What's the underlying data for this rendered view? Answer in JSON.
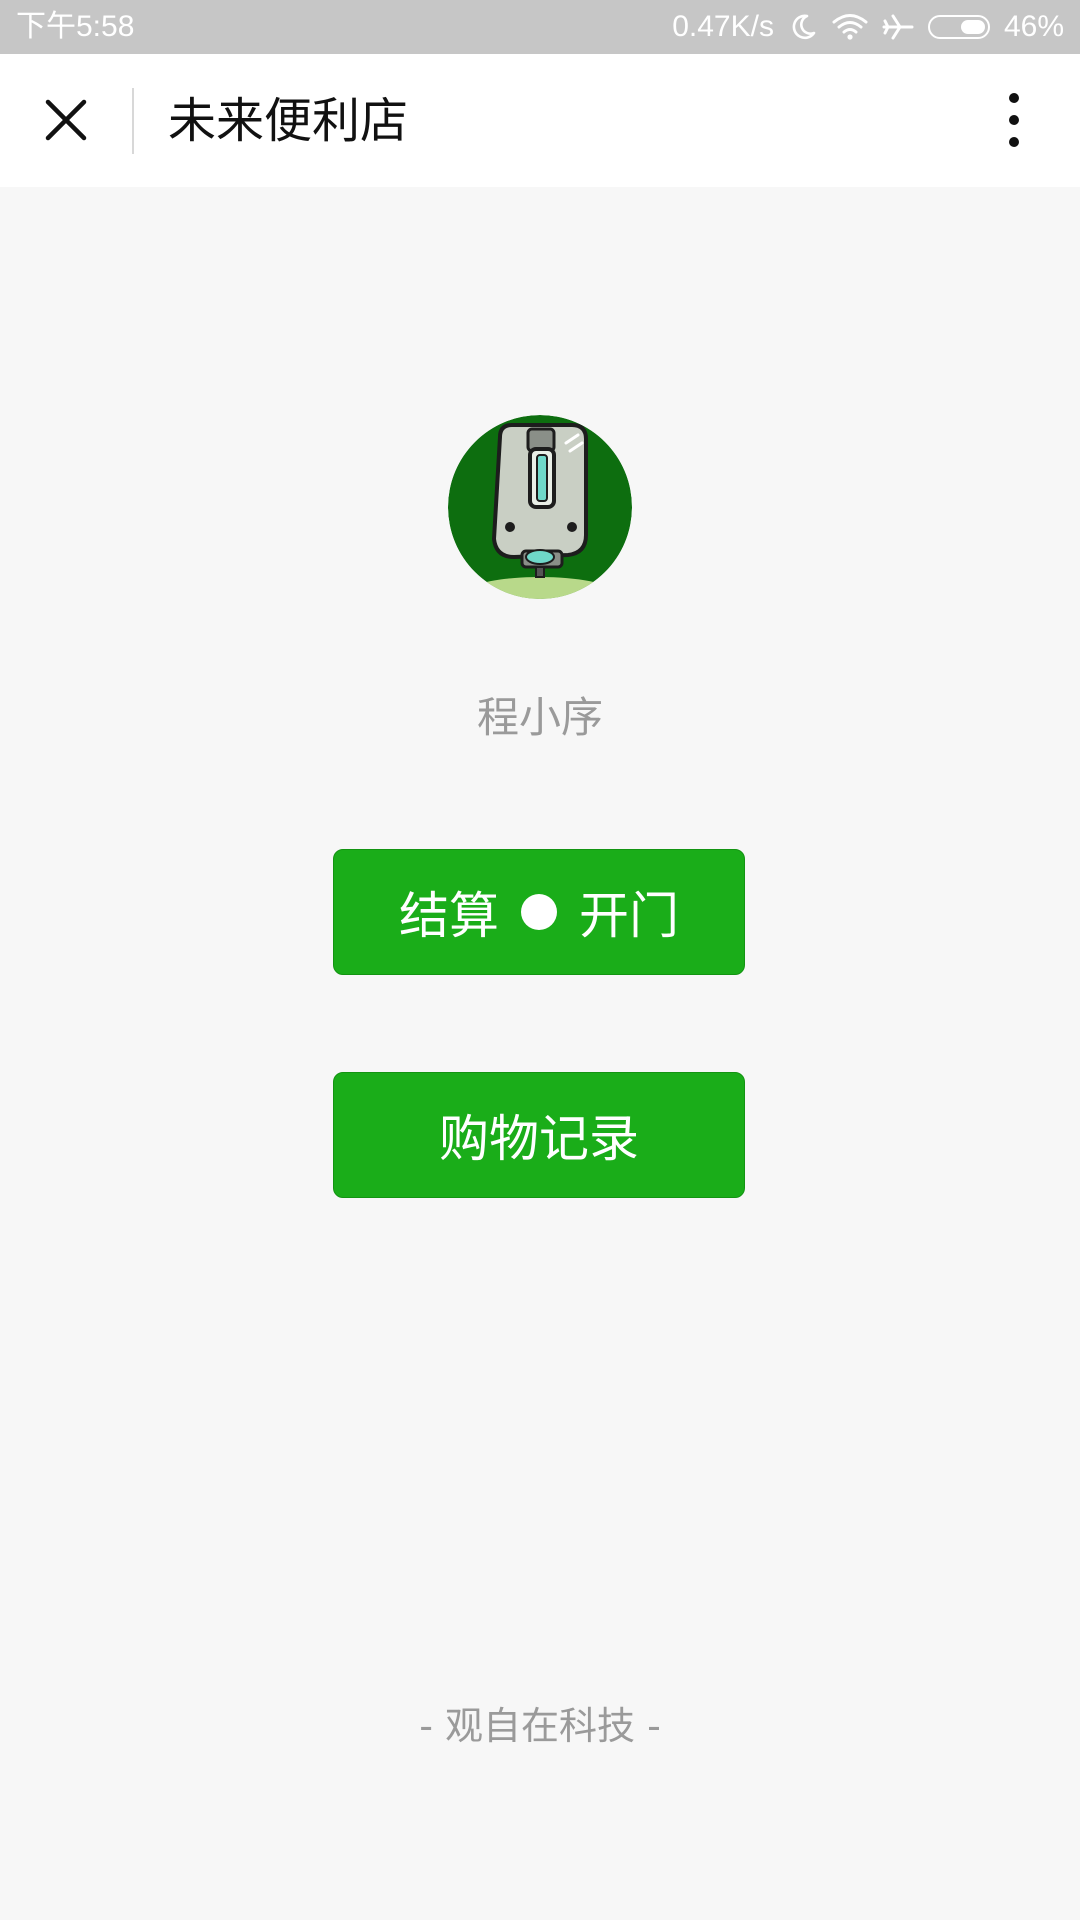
{
  "status_bar": {
    "time": "下午5:58",
    "network_speed": "0.47K/s",
    "battery_percent": "46%",
    "battery_level": 0.46,
    "icons": [
      "moon-icon",
      "wifi-icon",
      "airplane-icon",
      "battery-icon"
    ]
  },
  "header": {
    "title": "未来便利店",
    "close_icon": "close-icon",
    "more_icon": "more-vertical-icon"
  },
  "profile": {
    "name": "程小序",
    "avatar_icon": "robot-avatar"
  },
  "buttons": {
    "checkout_left": "结算",
    "checkout_right": "开门",
    "history": "购物记录"
  },
  "footer": {
    "text": "- 观自在科技 -"
  },
  "colors": {
    "status_bar_bg": "#c6c6c6",
    "page_bg": "#f7f7f7",
    "button_green": "#1aad19",
    "muted_text": "#9a9a9a"
  }
}
